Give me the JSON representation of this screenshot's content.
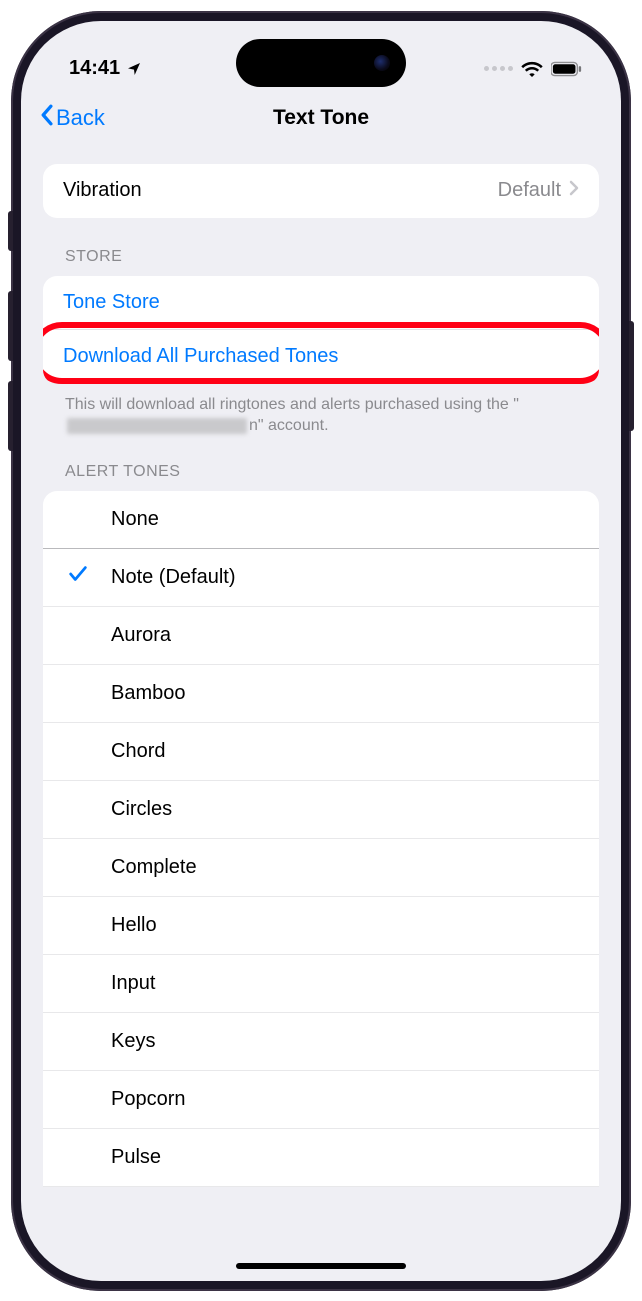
{
  "status": {
    "time": "14:41"
  },
  "nav": {
    "back_label": "Back",
    "title": "Text Tone"
  },
  "vibration": {
    "label": "Vibration",
    "value": "Default"
  },
  "store": {
    "header": "STORE",
    "tone_store": "Tone Store",
    "download_all": "Download All Purchased Tones",
    "footer_prefix": "This will download all ringtones and alerts purchased using the \"",
    "footer_suffix": "n\" account."
  },
  "alert_tones": {
    "header": "ALERT TONES",
    "selected": "Note (Default)",
    "items": [
      "None",
      "Note (Default)",
      "Aurora",
      "Bamboo",
      "Chord",
      "Circles",
      "Complete",
      "Hello",
      "Input",
      "Keys",
      "Popcorn",
      "Pulse"
    ]
  }
}
